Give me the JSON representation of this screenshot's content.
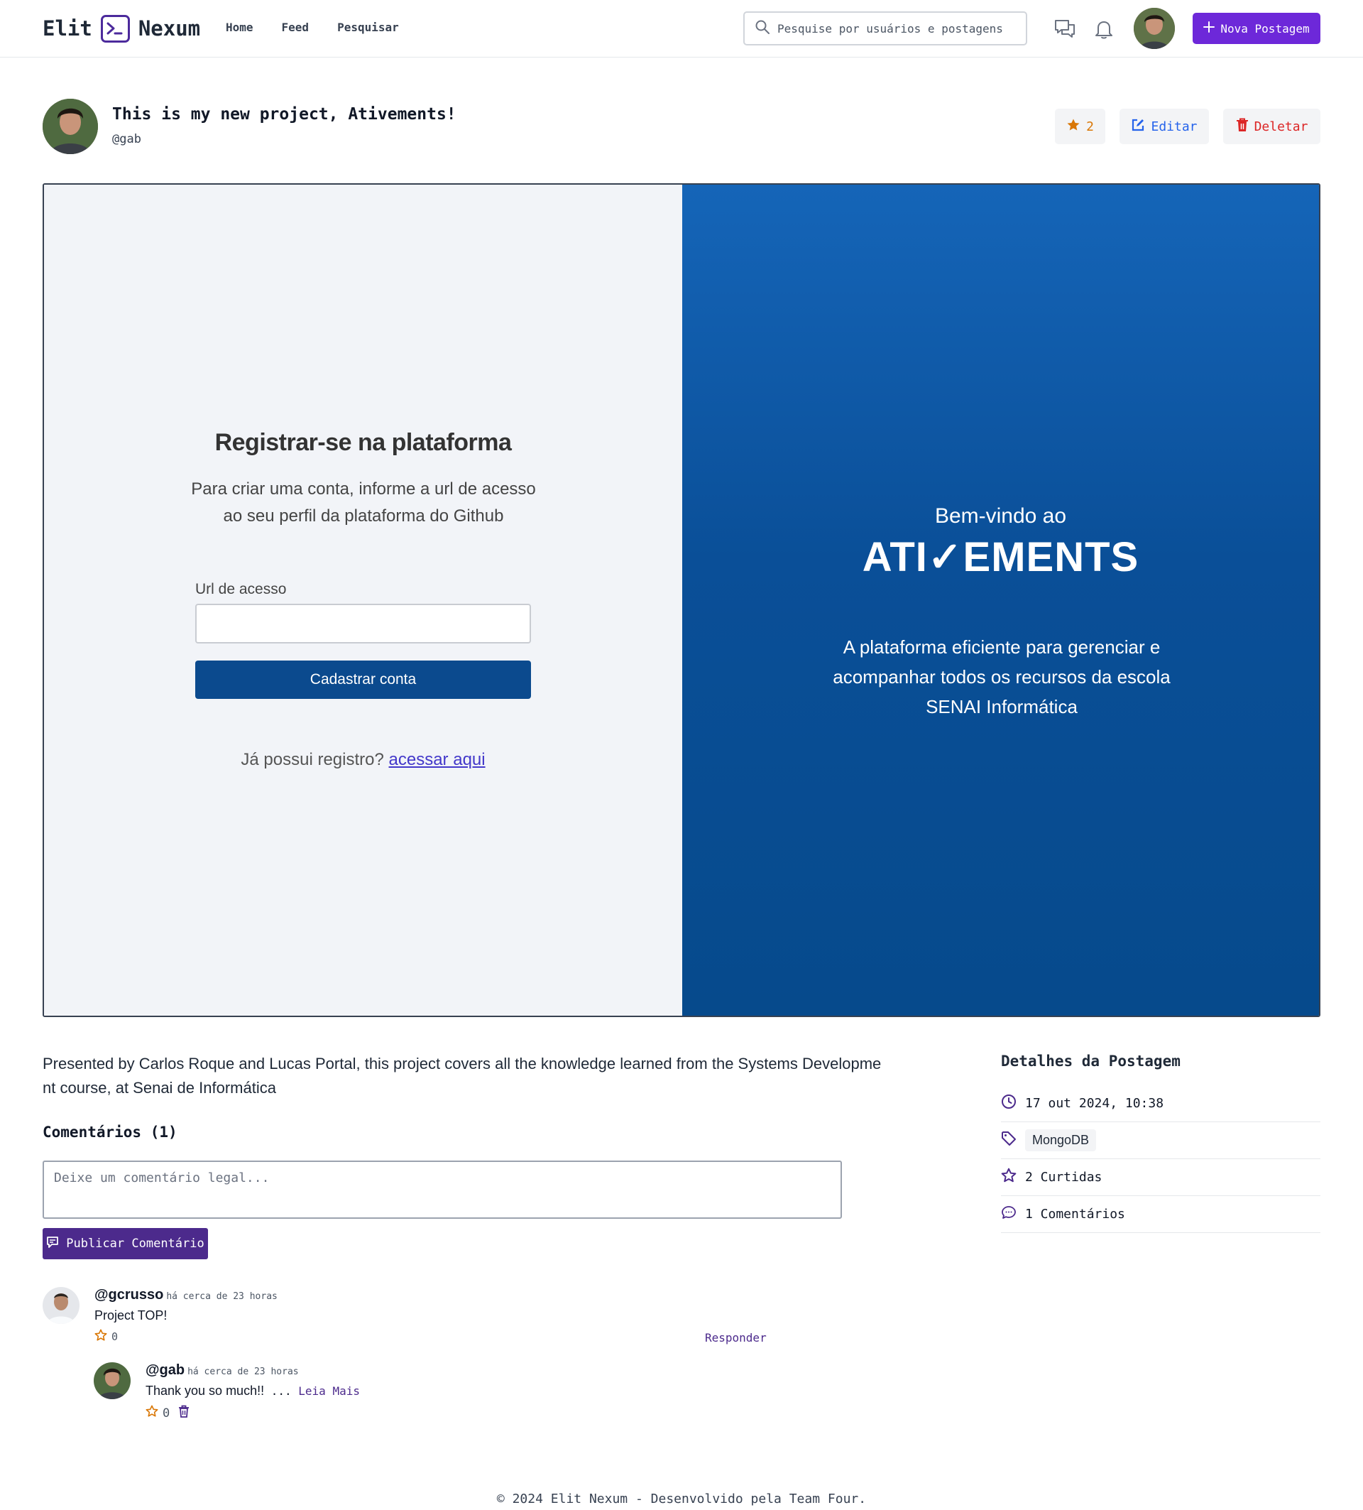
{
  "header": {
    "logo_left": "Elit",
    "logo_right": "Nexum",
    "nav": [
      "Home",
      "Feed",
      "Pesquisar"
    ],
    "search_placeholder": "Pesquise por usuários e postagens",
    "new_post_label": "Nova Postagem"
  },
  "post": {
    "title": "This is my new project, Ativements!",
    "username": "@gab",
    "stars": "2",
    "edit_label": "Editar",
    "delete_label": "Deletar",
    "description": "Presented by Carlos Roque and Lucas Portal, this project covers all the knowledge learned from the Systems Development course, at Senai de Informática"
  },
  "image": {
    "left_title": "Registrar-se na plataforma",
    "left_subtitle": "Para criar uma conta, informe a url de acesso ao seu perfil da plataforma do Github",
    "field_label": "Url de acesso",
    "button_label": "Cadastrar conta",
    "footer_text": "Já possui registro?",
    "footer_link": "acessar aqui",
    "right_welcome": "Bem-vindo ao",
    "right_brand": "ATI✓EMENTS",
    "right_desc": "A plataforma eficiente para gerenciar e acompanhar todos os recursos da escola SENAI Informática"
  },
  "comments": {
    "title": "Comentários (1)",
    "placeholder": "Deixe um comentário legal...",
    "publish_label": "Publicar Comentário",
    "items": [
      {
        "user": "@gcrusso",
        "time": "há cerca de 23 horas",
        "text": "Project TOP!",
        "stars": "0",
        "reply_label": "Responder"
      }
    ],
    "reply": {
      "user": "@gab",
      "time": "há cerca de 23 horas",
      "text": "Thank you so much!!",
      "ellipsis": "...",
      "read_more": "Leia Mais",
      "stars": "0"
    }
  },
  "details": {
    "title": "Detalhes da Postagem",
    "date": "17 out 2024, 10:38",
    "tag": "MongoDB",
    "likes": "2 Curtidas",
    "comments": "1 Comentários"
  },
  "footer": "© 2024 Elit Nexum - Desenvolvido pela Team Four.",
  "colors": {
    "brand": "#6d28d9",
    "brand_dark": "#4c2a8c",
    "star": "#d97706",
    "edit": "#2563eb",
    "delete": "#dc2626",
    "hero_blue": "#0a4f98"
  }
}
